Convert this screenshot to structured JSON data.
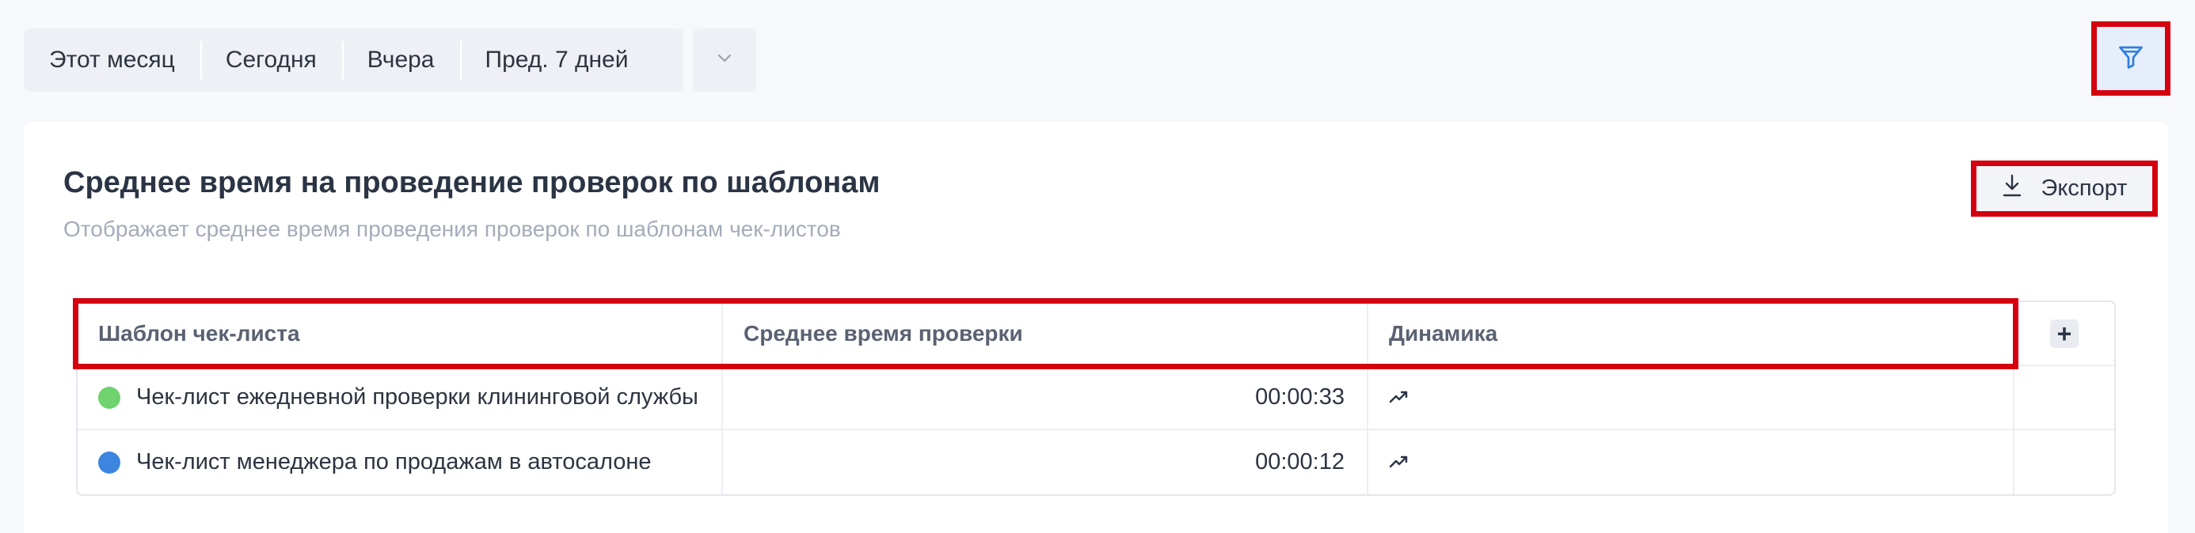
{
  "period_filter": {
    "options": [
      "Этот месяц",
      "Сегодня",
      "Вчера",
      "Пред. 7 дней"
    ]
  },
  "icons": {
    "more": "chevron-down-icon",
    "filter": "filter-icon",
    "export": "download-icon",
    "trend": "trend-up-icon",
    "add": "plus-icon"
  },
  "card": {
    "title": "Среднее время на проведение проверок по шаблонам",
    "subtitle": "Отображает среднее время проведения проверок по шаблонам чек-листов",
    "export_label": "Экспорт"
  },
  "table": {
    "columns": [
      "Шаблон чек-листа",
      "Среднее время проверки",
      "Динамика"
    ],
    "add_column_label": "+",
    "rows": [
      {
        "template": "Чек-лист ежедневной проверки клининговой службы",
        "color": "#6fd36f",
        "avg_time": "00:00:33"
      },
      {
        "template": "Чек-лист менеджера по продажам в автосалоне",
        "color": "#3d86e0",
        "avg_time": "00:00:12"
      }
    ]
  },
  "colors": {
    "highlight": "#d4000f",
    "accent": "#2f7de1"
  }
}
